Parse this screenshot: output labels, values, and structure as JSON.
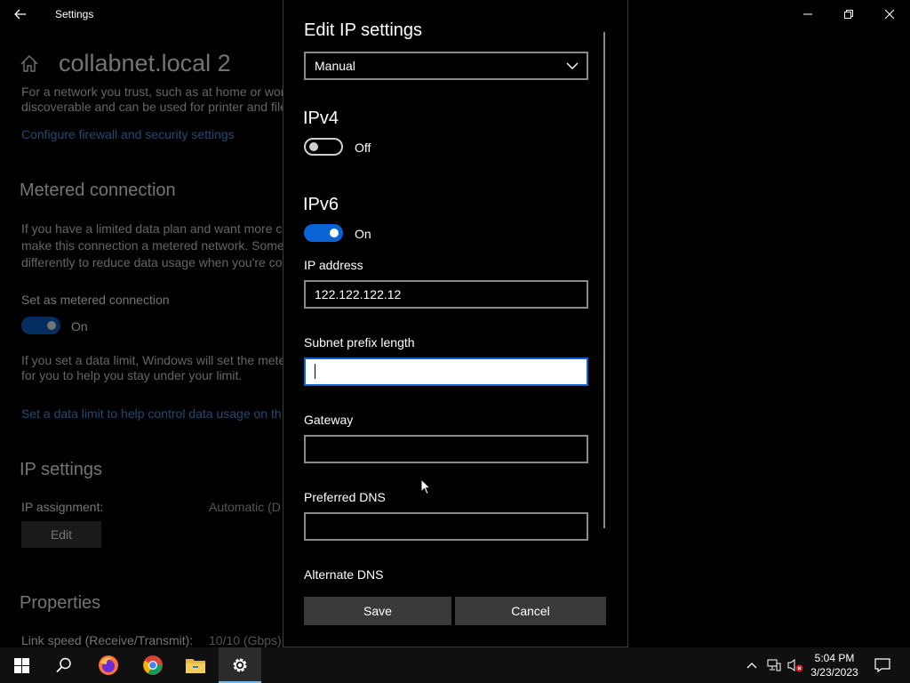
{
  "window": {
    "title": "Settings",
    "network_name": "collabnet.local 2",
    "intro_text_1": "For a network you trust, such as at home or wor",
    "intro_text_2": "discoverable and can be used for printer and file",
    "firewall_link": "Configure firewall and security settings",
    "metered": {
      "heading": "Metered connection",
      "text_1": "If you have a limited data plan and want more c",
      "text_2": "make this connection a metered network. Some",
      "text_3": "differently to reduce data usage when you're co",
      "set_label": "Set as metered connection",
      "toggle_state": "On",
      "limit_text_1": "If you set a data limit, Windows will set the mete",
      "limit_text_2": "for you to help you stay under your limit.",
      "limit_link": "Set a data limit to help control data usage on th"
    },
    "ip_settings": {
      "heading": "IP settings",
      "assignment_label": "IP assignment:",
      "assignment_value": "Automatic (D",
      "edit_label": "Edit"
    },
    "properties": {
      "heading": "Properties",
      "link_speed_label": "Link speed (Receive/Transmit):",
      "link_speed_value": "10/10 (Gbps)"
    }
  },
  "dialog": {
    "title": "Edit IP settings",
    "mode": "Manual",
    "ipv4": {
      "heading": "IPv4",
      "state": "Off"
    },
    "ipv6": {
      "heading": "IPv6",
      "state": "On"
    },
    "fields": {
      "ip_address": {
        "label": "IP address",
        "value": "122.122.122.12"
      },
      "subnet_prefix": {
        "label": "Subnet prefix length",
        "value": ""
      },
      "gateway": {
        "label": "Gateway",
        "value": ""
      },
      "preferred_dns": {
        "label": "Preferred DNS",
        "value": ""
      },
      "alternate_dns": {
        "label": "Alternate DNS",
        "value": ""
      }
    },
    "save_label": "Save",
    "cancel_label": "Cancel"
  },
  "taskbar": {
    "time": "5:04 PM",
    "date": "3/23/2023"
  },
  "colors": {
    "accent": "#0a64d6",
    "link": "#4aa3ff",
    "taskbar": "#101010"
  }
}
